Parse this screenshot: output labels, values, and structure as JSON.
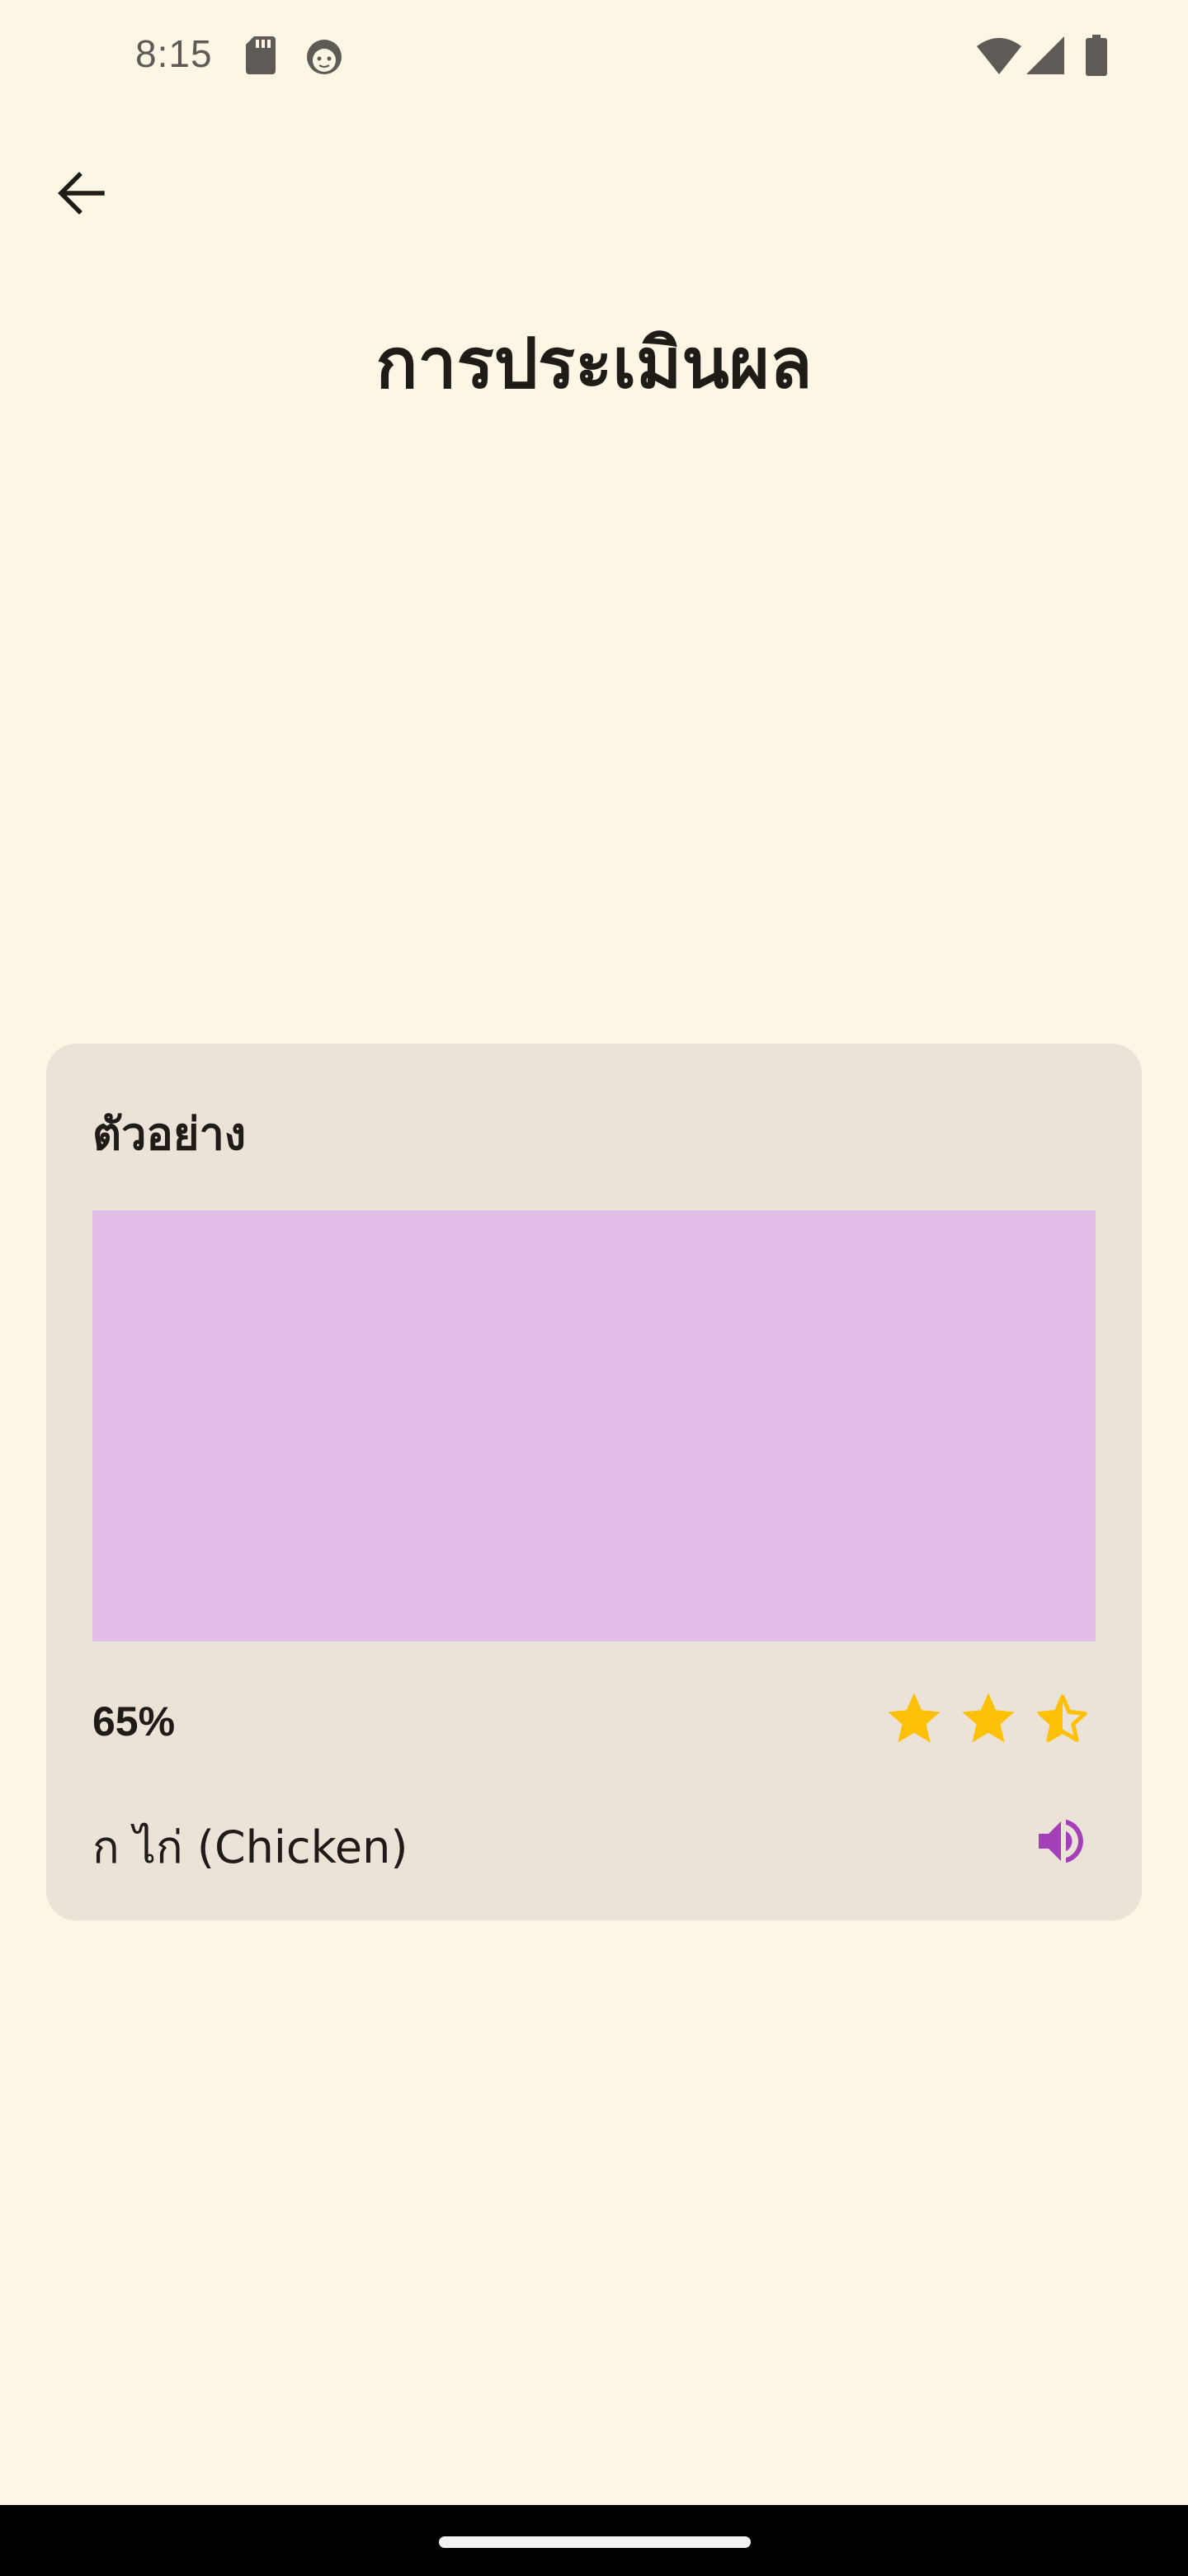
{
  "status_bar": {
    "time": "8:15",
    "icons": [
      "sd-card-icon",
      "face-icon",
      "wifi-icon",
      "signal-icon",
      "battery-icon"
    ]
  },
  "header": {
    "back_icon": "arrow-back-icon",
    "title": "การประเมินผล"
  },
  "card": {
    "title": "ตัวอย่าง",
    "image_color": "#E0BCE7",
    "score": "65%",
    "rating": {
      "value": 2.5,
      "max": 3
    },
    "word": "ก ไก่ (Chicken)",
    "speaker_icon": "volume-up-icon"
  },
  "colors": {
    "background": "#FDF6E4",
    "card": "#EBE3D7",
    "star": "#FFC107",
    "accent": "#A33FB7"
  }
}
